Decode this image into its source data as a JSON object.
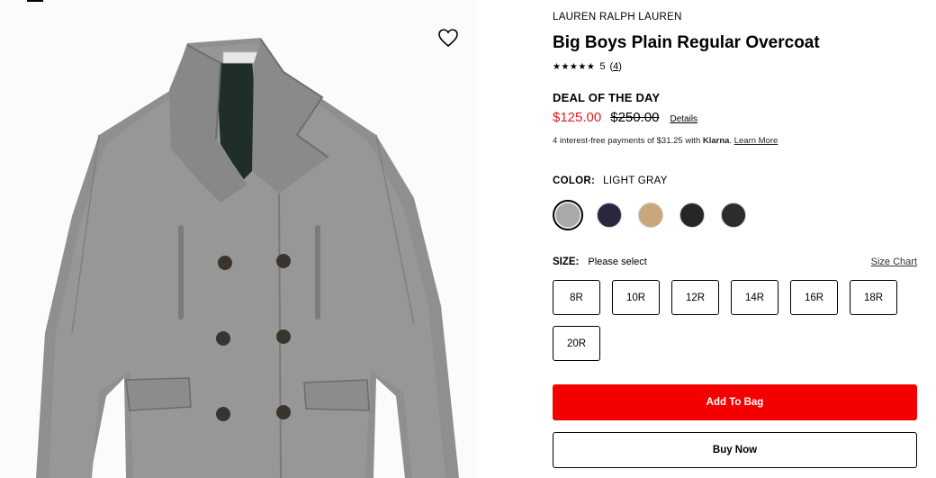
{
  "product": {
    "brand": "LAUREN RALPH LAUREN",
    "title": "Big Boys Plain Regular Overcoat",
    "image_icon": "overcoat-product-image",
    "wishlist_icon": "heart-icon"
  },
  "rating": {
    "stars": "★★★★★",
    "score": "5",
    "review_count": "4"
  },
  "deal": {
    "label": "DEAL OF THE DAY",
    "sale_price": "$125.00",
    "original_price": "$250.00",
    "details_link": "Details"
  },
  "klarna": {
    "prefix": "4 interest-free payments of $31.25 with ",
    "brand": "Klarna",
    "suffix": ". ",
    "learn_more": "Learn More"
  },
  "color": {
    "label": "COLOR:",
    "selected": "LIGHT GRAY",
    "swatches": [
      "#a9a9a9",
      "#2b2540",
      "#c9a77a",
      "#262626",
      "#2c2c2c"
    ]
  },
  "size": {
    "label": "SIZE:",
    "selected": "Please select",
    "chart_link": "Size Chart",
    "options": [
      "8R",
      "10R",
      "12R",
      "14R",
      "16R",
      "18R",
      "20R"
    ]
  },
  "actions": {
    "add_to_bag": "Add To Bag",
    "buy_now": "Buy Now"
  },
  "colors": {
    "sale_red": "#e11b22",
    "bag_red": "#f40000"
  }
}
